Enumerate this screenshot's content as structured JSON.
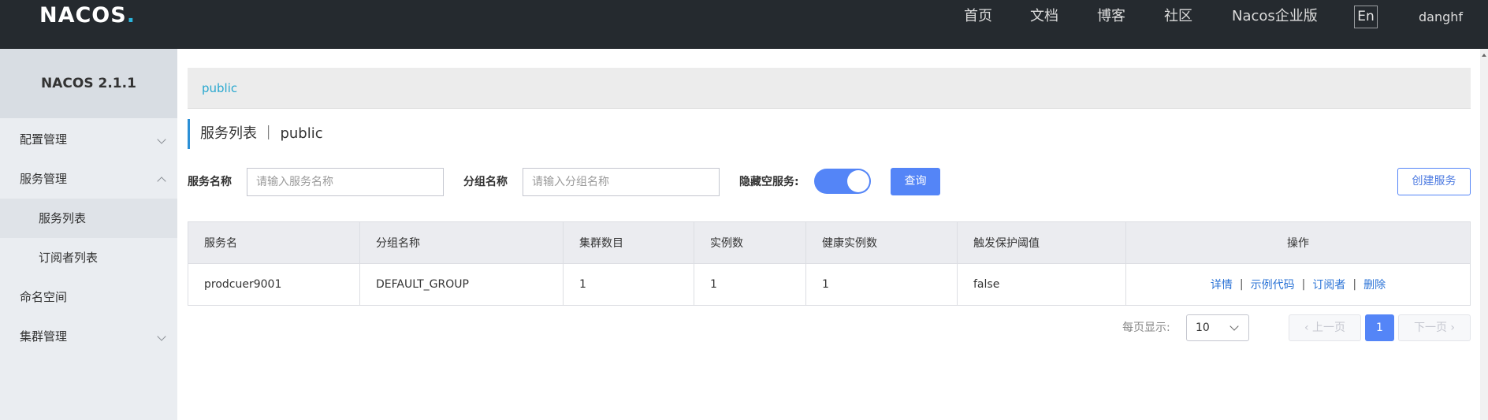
{
  "header": {
    "logo": "NACOS",
    "logo_dot": ".",
    "nav": [
      "首页",
      "文档",
      "博客",
      "社区",
      "Nacos企业版"
    ],
    "lang": "En",
    "user": "danghf"
  },
  "sidebar": {
    "title": "NACOS 2.1.1",
    "items": [
      {
        "label": "配置管理",
        "chevron": "down"
      },
      {
        "label": "服务管理",
        "chevron": "up"
      },
      {
        "label": "服务列表",
        "sub": true,
        "active": true
      },
      {
        "label": "订阅者列表",
        "sub": true
      },
      {
        "label": "命名空间"
      },
      {
        "label": "集群管理",
        "chevron": "down"
      }
    ]
  },
  "breadcrumb": "public",
  "page_title": "服务列表 ｜ public",
  "search": {
    "service_label": "服务名称",
    "service_placeholder": "请输入服务名称",
    "group_label": "分组名称",
    "group_placeholder": "请输入分组名称",
    "hide_empty_label": "隐藏空服务:",
    "hide_empty_on": true,
    "query_button": "查询",
    "create_button": "创建服务"
  },
  "table": {
    "headers": [
      "服务名",
      "分组名称",
      "集群数目",
      "实例数",
      "健康实例数",
      "触发保护阈值",
      "操作"
    ],
    "rows": [
      {
        "name": "prodcuer9001",
        "group": "DEFAULT_GROUP",
        "clusters": "1",
        "instances": "1",
        "healthy": "1",
        "threshold": "false"
      }
    ],
    "ops": [
      "详情",
      "示例代码",
      "订阅者",
      "删除"
    ]
  },
  "pagination": {
    "page_size_label": "每页显示:",
    "page_size": "10",
    "prev": "上一页",
    "current": "1",
    "next": "下一页"
  },
  "colors": {
    "accent": "#5485f7",
    "header_bg": "#252a2f",
    "link": "#2b73d6"
  }
}
